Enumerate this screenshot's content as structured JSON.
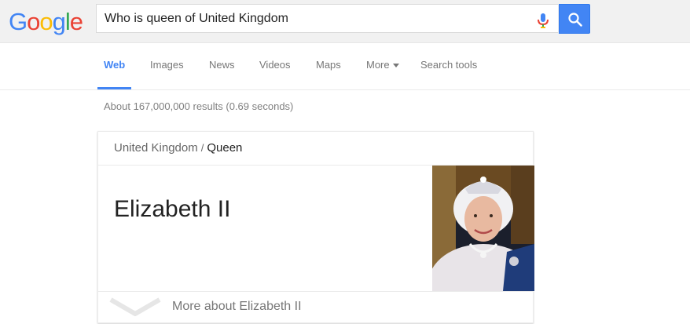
{
  "header": {
    "logo": "Google",
    "query": "Who is queen of United Kingdom",
    "mic_icon": "microphone-icon",
    "search_icon": "magnifier-icon"
  },
  "tabs": [
    {
      "label": "Web",
      "active": true
    },
    {
      "label": "Images"
    },
    {
      "label": "News"
    },
    {
      "label": "Videos"
    },
    {
      "label": "Maps"
    },
    {
      "label": "More"
    },
    {
      "label": "Search tools"
    }
  ],
  "results": {
    "stats": "About 167,000,000 results (0.69 seconds)"
  },
  "answer_card": {
    "breadcrumb_parent": "United Kingdom",
    "breadcrumb_separator": "/",
    "breadcrumb_current": "Queen",
    "answer": "Elizabeth II",
    "image_alt": "portrait-of-elizabeth-ii",
    "more_link": "More about Elizabeth II"
  },
  "colors": {
    "accent_blue": "#4285f4",
    "logo_blue": "#4285f4",
    "logo_red": "#ea4335",
    "logo_yellow": "#fbbc05",
    "logo_green": "#34a853"
  }
}
